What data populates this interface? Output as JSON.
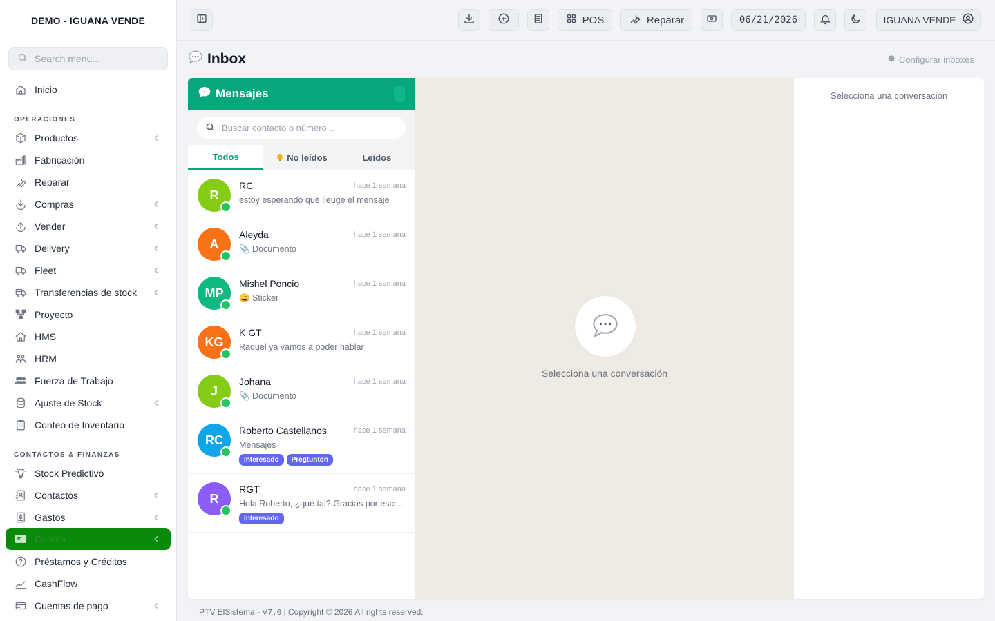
{
  "sidebar": {
    "brand": "DEMO - IGUANA VENDE",
    "search_placeholder": "Search menu...",
    "home": "Inicio",
    "section_ops": "OPERACIONES",
    "ops": [
      {
        "label": "Productos",
        "icon": "box-icon",
        "chevron": true
      },
      {
        "label": "Fabricación",
        "icon": "factory-icon",
        "chevron": false
      },
      {
        "label": "Reparar",
        "icon": "wrench-icon",
        "chevron": false
      },
      {
        "label": "Compras",
        "icon": "download-icon",
        "chevron": true
      },
      {
        "label": "Vender",
        "icon": "upload-icon",
        "chevron": true
      },
      {
        "label": "Delivery",
        "icon": "delivery-truck-icon",
        "chevron": true
      },
      {
        "label": "Fleet",
        "icon": "truck-icon",
        "chevron": true
      },
      {
        "label": "Transferencias de stock",
        "icon": "transfer-truck-icon",
        "chevron": true
      },
      {
        "label": "Proyecto",
        "icon": "project-tree-icon",
        "chevron": false
      },
      {
        "label": "HMS",
        "icon": "building-icon",
        "chevron": false
      },
      {
        "label": "HRM",
        "icon": "people-icon",
        "chevron": false
      },
      {
        "label": "Fuerza de Trabajo",
        "icon": "team-icon",
        "chevron": false
      },
      {
        "label": "Ajuste de Stock",
        "icon": "database-icon",
        "chevron": true
      },
      {
        "label": "Conteo de Inventario",
        "icon": "clipboard-icon",
        "chevron": false
      }
    ],
    "section_fin": "CONTACTOS & FINANZAS",
    "fin": [
      {
        "label": "Stock Predictivo",
        "icon": "lightbulb-icon",
        "chevron": false
      },
      {
        "label": "Contactos",
        "icon": "contacts-book-icon",
        "chevron": true
      },
      {
        "label": "Gastos",
        "icon": "dollar-file-icon",
        "chevron": true
      },
      {
        "label": "Cuenta",
        "icon": "bank-card-icon",
        "chevron": true,
        "active": true
      },
      {
        "label": "Préstamos y Créditos",
        "icon": "question-circle-icon",
        "chevron": false
      },
      {
        "label": "CashFlow",
        "icon": "chart-line-icon",
        "chevron": false
      },
      {
        "label": "Cuentas de pago",
        "icon": "credit-card-icon",
        "chevron": true
      }
    ]
  },
  "topbar": {
    "pos_label": "POS",
    "repair_label": "Reparar",
    "date": "06/21/2026",
    "user_label": "IGUANA VENDE"
  },
  "page": {
    "title": "Inbox",
    "config_link": "Configurar inboxes"
  },
  "inbox": {
    "header": "Mensajes",
    "search_placeholder": "Buscar contacto o número...",
    "tabs": {
      "all": "Todos",
      "unread": "No leídos",
      "read": "Leídos"
    },
    "conversations": [
      {
        "initials": "R",
        "name": "RC",
        "time": "hace 1 semana",
        "message": "estoy esperando que lleuge el mensaje",
        "color": "#84cc16",
        "tags": []
      },
      {
        "initials": "A",
        "name": "Aleyda",
        "time": "hace 1 semana",
        "message": "📎 Documento",
        "color": "#f97316",
        "tags": []
      },
      {
        "initials": "MP",
        "name": "Mishel Poncio",
        "time": "hace 1 semana",
        "message": "😀 Sticker",
        "color": "#10b981",
        "tags": []
      },
      {
        "initials": "KG",
        "name": "K GT",
        "time": "hace 1 semana",
        "message": "Raquel ya vamos a poder hablar",
        "color": "#f97316",
        "tags": []
      },
      {
        "initials": "J",
        "name": "Johana",
        "time": "hace 1 semana",
        "message": "📎 Documento",
        "color": "#84cc16",
        "tags": []
      },
      {
        "initials": "RC",
        "name": "Roberto Castellanos",
        "time": "hace 1 semana",
        "message": "Mensajes",
        "color": "#0ea5e9",
        "tags": [
          "Interesado",
          "Pregtunton"
        ]
      },
      {
        "initials": "R",
        "name": "RGT",
        "time": "hace 1 semana",
        "message": "Hola Roberto, ¿qué tal? Gracias por escribirnos",
        "color": "#8b5cf6",
        "tags": [
          "Interesado"
        ]
      }
    ],
    "empty_text": "Selecciona una conversación",
    "details_text": "Selecciona una conversación"
  },
  "footer": {
    "prefix": "PTV ElSistema - V",
    "version": "7.0",
    "suffix": " | Copyright © 2026 All rights reserved."
  }
}
